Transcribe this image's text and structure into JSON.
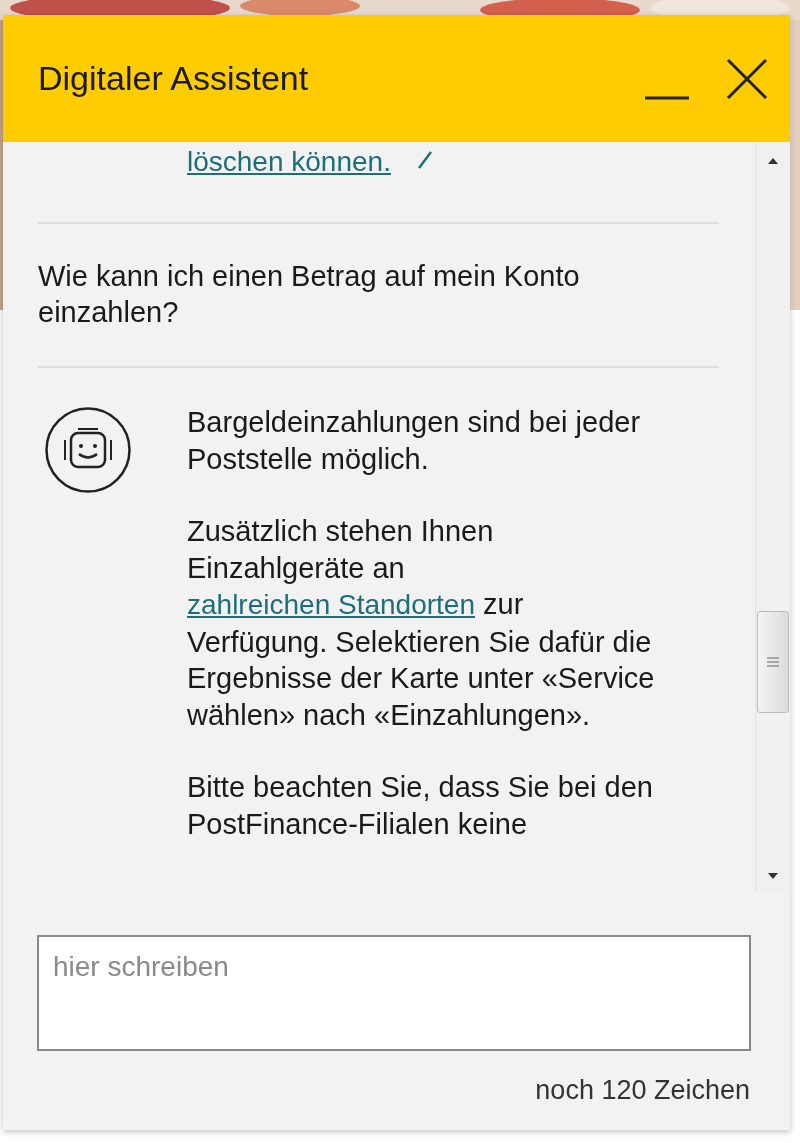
{
  "window": {
    "title": "Digitaler Assistent"
  },
  "conversation": [
    {
      "kind": "link",
      "text": "löschen können."
    },
    {
      "kind": "question",
      "text": "Wie kann ich einen Betrag auf mein Konto einzahlen?"
    },
    {
      "kind": "answer",
      "paragraphs": [
        [
          {
            "kind": "text",
            "text": "Bargeldeinzahlungen sind bei jeder Poststelle möglich."
          }
        ],
        [
          {
            "kind": "text",
            "text": "Zusätzlich stehen Ihnen Einzahlgeräte an "
          },
          {
            "kind": "link",
            "text": "zahlreichen Standorten"
          },
          {
            "kind": "text",
            "text": " zur Verfügung. Selektieren Sie dafür die Ergebnisse der Karte unter «Service wählen» nach «Einzahlungen»."
          }
        ],
        [
          {
            "kind": "text",
            "text": "Bitte beachten Sie, dass Sie bei den PostFinance-Filialen keine"
          }
        ]
      ]
    }
  ],
  "input": {
    "placeholder": "hier schreiben"
  },
  "counter": "noch 120 Zeichen"
}
